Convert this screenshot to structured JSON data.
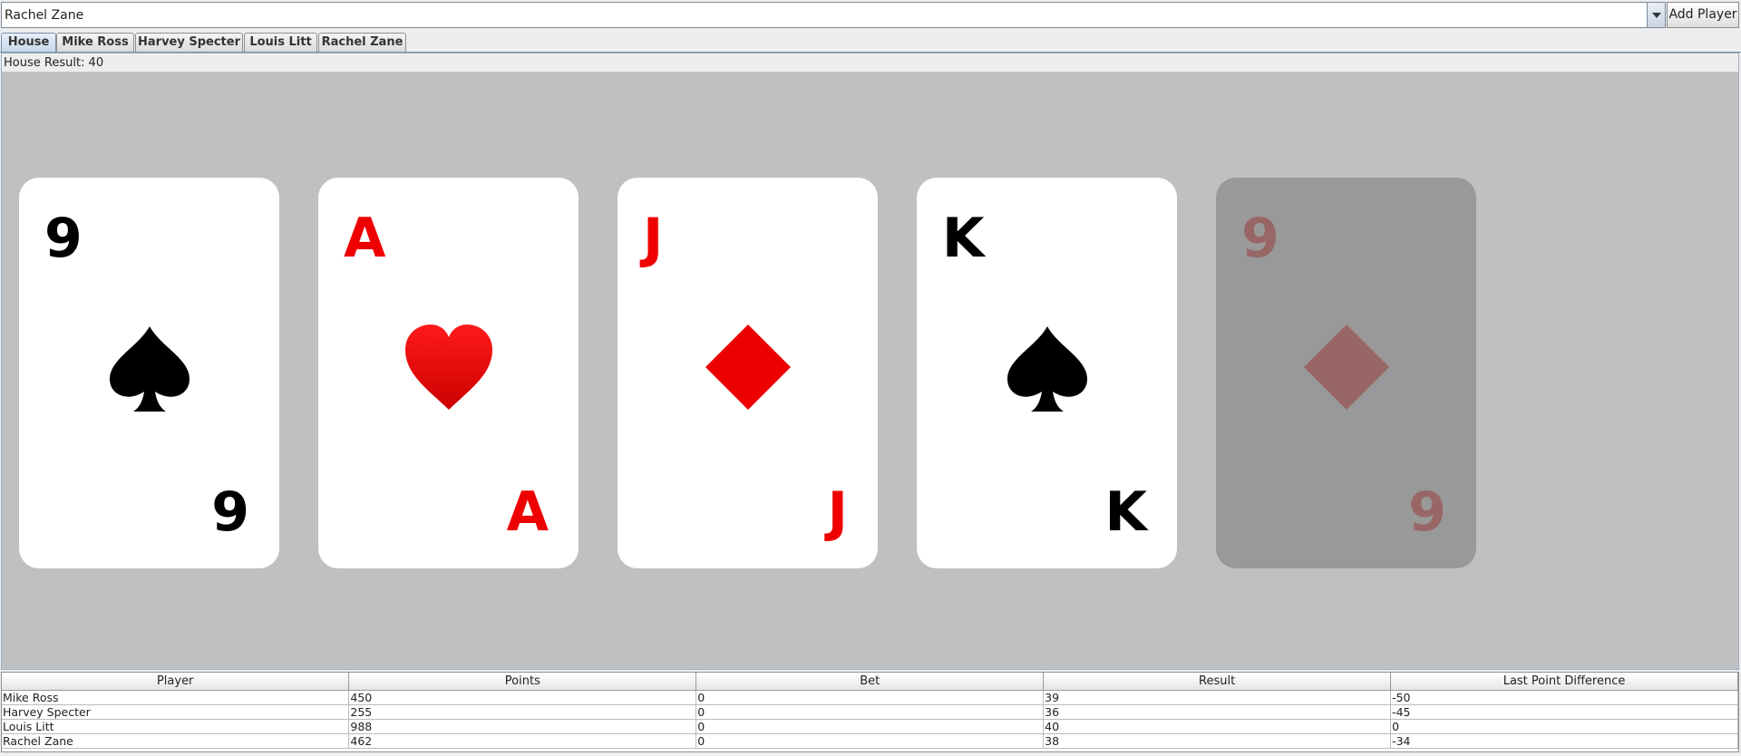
{
  "player_select": {
    "value": "Rachel Zane"
  },
  "add_player_label": "Add Player",
  "tabs": [
    {
      "label": "House",
      "active": true
    },
    {
      "label": "Mike Ross",
      "active": false
    },
    {
      "label": "Harvey Specter",
      "active": false
    },
    {
      "label": "Louis Litt",
      "active": false
    },
    {
      "label": "Rachel Zane",
      "active": false
    }
  ],
  "house_result": "House Result: 40",
  "cards": [
    {
      "rank": "9",
      "suit": "spade",
      "color": "#000000",
      "dimmed": false
    },
    {
      "rank": "A",
      "suit": "heart",
      "color": "#ee0000",
      "dimmed": false
    },
    {
      "rank": "J",
      "suit": "diamond",
      "color": "#ee0000",
      "dimmed": false
    },
    {
      "rank": "K",
      "suit": "spade",
      "color": "#000000",
      "dimmed": false
    },
    {
      "rank": "9",
      "suit": "diamond",
      "color": "#996666",
      "dimmed": true
    }
  ],
  "results_table": {
    "columns": [
      "Player",
      "Points",
      "Bet",
      "Result",
      "Last Point Difference"
    ],
    "rows": [
      [
        "Mike Ross",
        "450",
        "0",
        "39",
        "-50"
      ],
      [
        "Harvey Specter",
        "255",
        "0",
        "36",
        "-45"
      ],
      [
        "Louis Litt",
        "988",
        "0",
        "40",
        "0"
      ],
      [
        "Rachel Zane",
        "462",
        "0",
        "38",
        "-34"
      ]
    ]
  }
}
